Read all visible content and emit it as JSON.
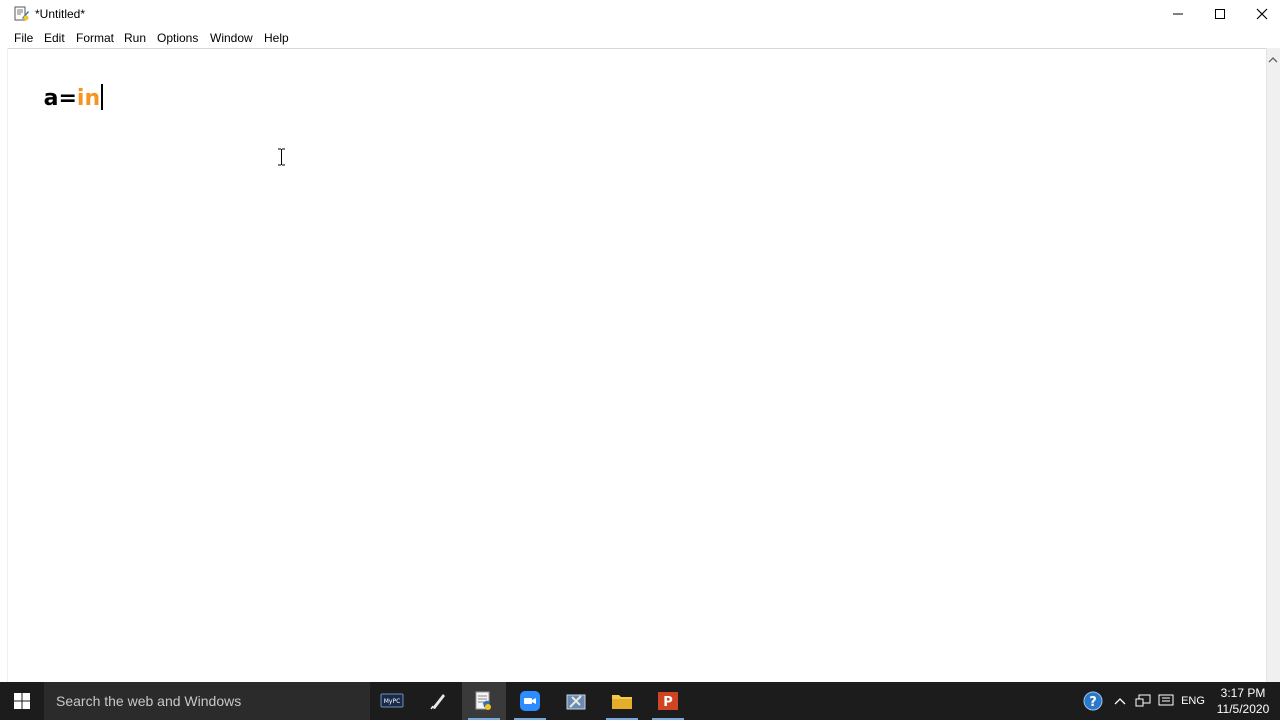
{
  "window": {
    "title": "*Untitled*"
  },
  "menubar": {
    "items": [
      "File",
      "Edit",
      "Format",
      "Run",
      "Options",
      "Window",
      "Help"
    ]
  },
  "editor": {
    "code_plain": "a=",
    "code_builtin": "in"
  },
  "colors": {
    "builtin": "#f7931e",
    "taskbar": "#1c1c1c",
    "search_box": "#2b2b2b"
  },
  "taskbar": {
    "search_placeholder": "Search the web and Windows",
    "apps": [
      "mypc-icon",
      "quill-icon",
      "python-idle-icon",
      "zoom-icon",
      "toolbox-icon",
      "file-explorer-icon",
      "powerpoint-icon"
    ],
    "active_app": "python-idle-icon",
    "language": "ENG",
    "time": "3:17 PM",
    "date": "11/5/2020"
  }
}
